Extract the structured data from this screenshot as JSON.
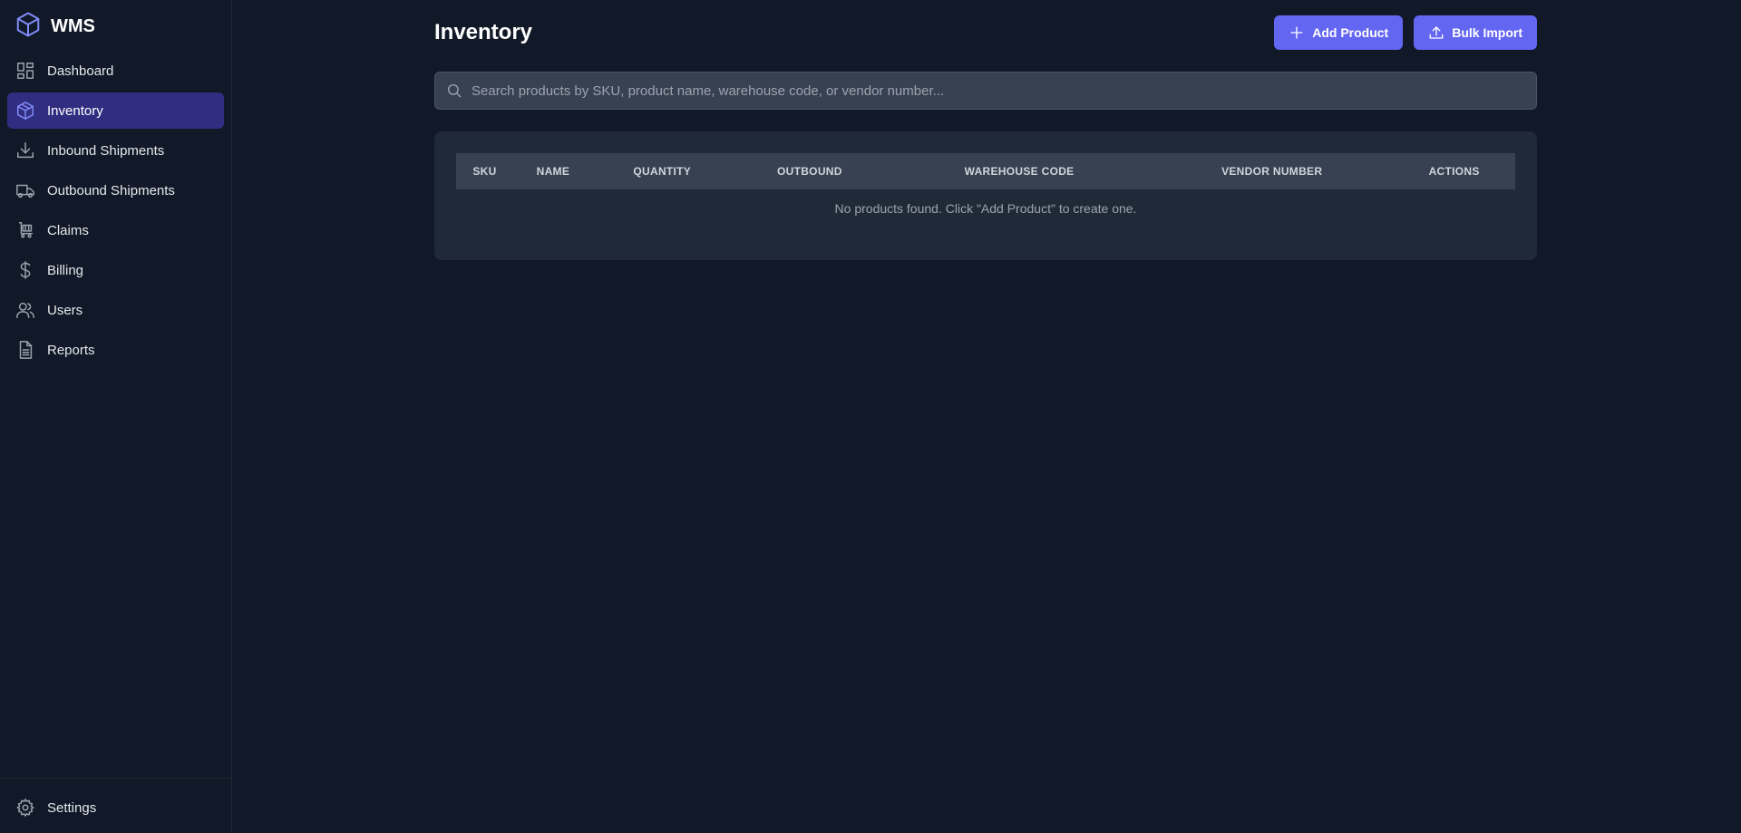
{
  "brand": {
    "name": "WMS"
  },
  "sidebar": {
    "items": [
      {
        "label": "Dashboard",
        "icon": "dashboard-icon",
        "active": false
      },
      {
        "label": "Inventory",
        "icon": "cube-icon",
        "active": true
      },
      {
        "label": "Inbound Shipments",
        "icon": "download-icon",
        "active": false
      },
      {
        "label": "Outbound Shipments",
        "icon": "truck-icon",
        "active": false
      },
      {
        "label": "Claims",
        "icon": "cart-icon",
        "active": false
      },
      {
        "label": "Billing",
        "icon": "dollar-icon",
        "active": false
      },
      {
        "label": "Users",
        "icon": "users-icon",
        "active": false
      },
      {
        "label": "Reports",
        "icon": "document-icon",
        "active": false
      }
    ],
    "settings": {
      "label": "Settings",
      "icon": "gear-icon"
    }
  },
  "page": {
    "title": "Inventory",
    "add_product_label": "Add Product",
    "bulk_import_label": "Bulk Import"
  },
  "search": {
    "placeholder": "Search products by SKU, product name, warehouse code, or vendor number...",
    "value": ""
  },
  "table": {
    "columns": [
      "SKU",
      "NAME",
      "QUANTITY",
      "OUTBOUND",
      "WAREHOUSE CODE",
      "VENDOR NUMBER",
      "ACTIONS"
    ],
    "empty_message": "No products found. Click \"Add Product\" to create one."
  },
  "colors": {
    "background": "#111827",
    "accent": "#6366f1",
    "active_nav": "#312e81",
    "card": "#1f2937"
  }
}
